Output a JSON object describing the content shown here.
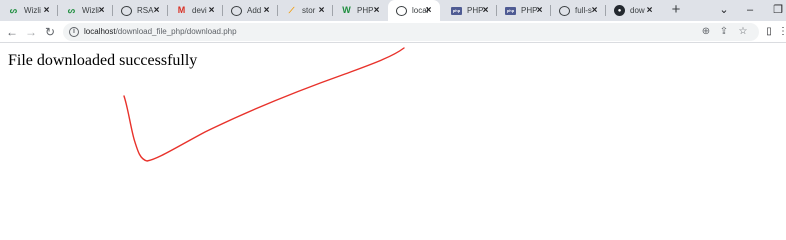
{
  "browser": {
    "tabs": [
      {
        "title": "Wizli",
        "icon": "wizli-icon",
        "active": false
      },
      {
        "title": "Wizli",
        "icon": "wizli-icon",
        "active": false
      },
      {
        "title": "RSA",
        "icon": "globe-icon",
        "active": false
      },
      {
        "title": "devi",
        "icon": "gmail-icon",
        "active": false
      },
      {
        "title": "Add",
        "icon": "globe-icon",
        "active": false
      },
      {
        "title": "stor",
        "icon": "star-icon",
        "active": false
      },
      {
        "title": "PHP",
        "icon": "w3schools-icon",
        "active": false
      },
      {
        "title": "local",
        "icon": "globe-icon",
        "active": true
      },
      {
        "title": "PHP",
        "icon": "php-icon",
        "active": false
      },
      {
        "title": "PHP",
        "icon": "php-icon",
        "active": false
      },
      {
        "title": "full-s",
        "icon": "globe-icon",
        "active": false
      },
      {
        "title": "dow",
        "icon": "github-icon",
        "active": false
      }
    ],
    "address": {
      "host": "localhost",
      "path": "/download_file_php/download.php"
    }
  },
  "page": {
    "message": "File downloaded successfully"
  },
  "colors": {
    "annotation_stroke": "#e8322b",
    "tabstrip_bg": "#dfe2e8"
  }
}
